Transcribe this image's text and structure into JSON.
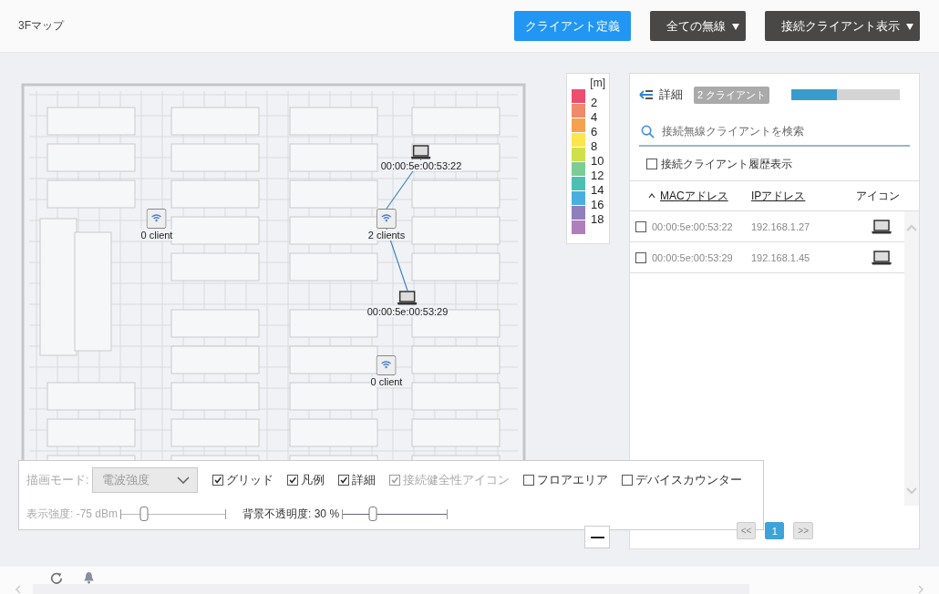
{
  "header": {
    "title": "3Fマップ",
    "buttons": [
      {
        "label": "クライアント定義",
        "kind": "primary"
      },
      {
        "label": "全ての無線",
        "kind": "dropdown"
      },
      {
        "label": "接続クライアント表示",
        "kind": "dropdown"
      }
    ]
  },
  "map": {
    "access_points": [
      {
        "label": "0 client"
      },
      {
        "label": "2 clients",
        "clients": [
          {
            "label": "00:00:5e:00:53:22"
          },
          {
            "label": "00:00:5e:00:53:29"
          }
        ]
      },
      {
        "label": "0 client"
      }
    ]
  },
  "legend": {
    "unit": "[m]",
    "items": [
      {
        "label": "2",
        "color": "#ee4d6f"
      },
      {
        "label": "4",
        "color": "#ef8a6c"
      },
      {
        "label": "6",
        "color": "#f4a24e"
      },
      {
        "label": "8",
        "color": "#fde64b"
      },
      {
        "label": "10",
        "color": "#cfe04b"
      },
      {
        "label": "12",
        "color": "#7dcc96"
      },
      {
        "label": "14",
        "color": "#4cbfb5"
      },
      {
        "label": "16",
        "color": "#4aafdf"
      },
      {
        "label": "18",
        "color": "#8f7fba"
      },
      {
        "color": "#b07fba"
      }
    ]
  },
  "settings": {
    "mode": {
      "label": "描画モード:",
      "value": "電波強度",
      "disabled": true
    },
    "checkboxes": [
      {
        "label": "グリッド",
        "checked": true,
        "disabled": false
      },
      {
        "label": "凡例",
        "checked": true,
        "disabled": false
      },
      {
        "label": "詳細",
        "checked": true,
        "disabled": false
      },
      {
        "label": "接続健全性アイコン",
        "checked": true,
        "disabled": true
      },
      {
        "label": "フロアエリア",
        "checked": false,
        "disabled": false
      },
      {
        "label": "デバイスカウンター",
        "checked": false,
        "disabled": false
      }
    ],
    "sliders": [
      {
        "label": "表示強度: -75 dBm",
        "level": 0.22,
        "disabled": true
      },
      {
        "label": "背景不透明度: 30 %",
        "level": 0.29,
        "disabled": false
      }
    ]
  },
  "panel": {
    "title": "詳細",
    "badge": "2 クライアント",
    "progress": {
      "level": 0.42
    },
    "search": {
      "placeholder": "接続無線クライアントを検索"
    },
    "history": {
      "label": "接続クライアント履歴表示",
      "checked": false
    },
    "table": {
      "columns": [
        {
          "label": "MACアドレス",
          "sort_ascending": true
        },
        {
          "label": "IPアドレス"
        },
        {
          "label": "アイコン"
        }
      ],
      "rows": [
        {
          "mac": "00:00:5e:00:53:22",
          "ip": "192.168.1.27",
          "checked": false
        },
        {
          "mac": "00:00:5e:00:53:29",
          "ip": "192.168.1.45",
          "checked": false
        }
      ]
    },
    "pagination": {
      "prev": "<<",
      "pages": [
        {
          "label": "1",
          "selected": true
        }
      ],
      "next": ">>"
    }
  }
}
